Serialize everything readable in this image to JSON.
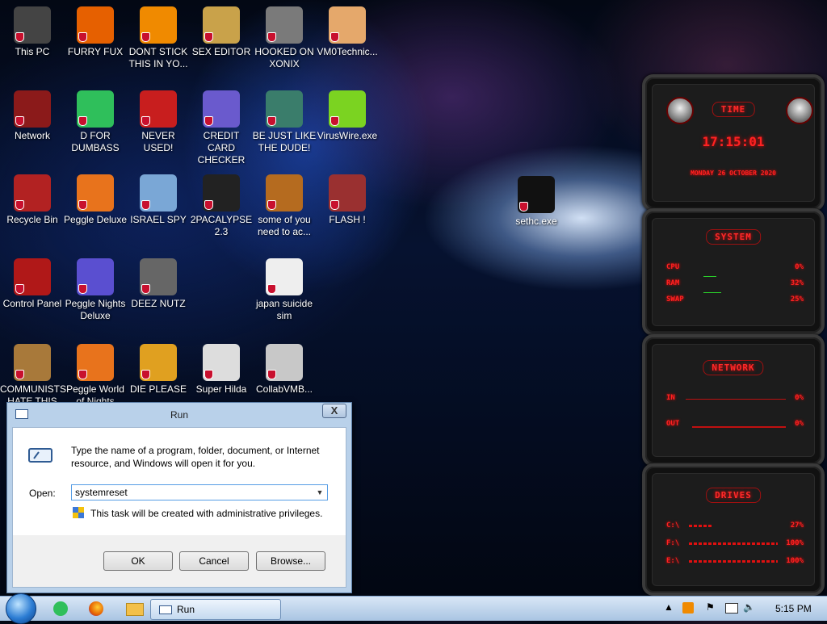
{
  "desktop": {
    "icons": [
      {
        "label": "This PC",
        "icon": "computer-icon",
        "color": "#444"
      },
      {
        "label": "FURRY FUX",
        "icon": "firefox-icon",
        "color": "#e66000"
      },
      {
        "label": "DONT STICK THIS IN YO...",
        "icon": "vlc-cone-icon",
        "color": "#f08a00"
      },
      {
        "label": "SEX EDITOR",
        "icon": "hxd-hex-editor-icon",
        "color": "#c9a24a"
      },
      {
        "label": "HOOKED ON XONIX",
        "icon": "xonix-game-icon",
        "color": "#7a7a7a"
      },
      {
        "label": "VM0Technic...",
        "icon": "technician-avatar-icon",
        "color": "#e5a86b"
      },
      {
        "label": "Network",
        "icon": "network-icon",
        "color": "#8b1a1a"
      },
      {
        "label": "D FOR DUMBASS",
        "icon": "messaging-app-icon",
        "color": "#2fbf5b"
      },
      {
        "label": "NEVER USED!",
        "icon": "dev-cpp-icon",
        "color": "#c81e1e"
      },
      {
        "label": "CREDIT CARD CHECKER",
        "icon": "credit-card-icon",
        "color": "#6a5acd"
      },
      {
        "label": "BE JUST LIKE THE DUDE!",
        "icon": "santa-avatar-icon",
        "color": "#3a7d6b"
      },
      {
        "label": "VirusWire.exe",
        "icon": "lime-slice-icon",
        "color": "#7bd321"
      },
      {
        "label": "Recycle Bin",
        "icon": "recycle-bin-icon",
        "color": "#b22222"
      },
      {
        "label": "Peggle Deluxe",
        "icon": "peggle-icon",
        "color": "#e8731c"
      },
      {
        "label": "ISRAEL SPY",
        "icon": "network-share-icon",
        "color": "#7aa7d6"
      },
      {
        "label": "2PACALYPSE 2.3",
        "icon": "terminal-icon",
        "color": "#222"
      },
      {
        "label": "some of you need to ac...",
        "icon": "cartoon-dog-icon",
        "color": "#b56b1f"
      },
      {
        "label": "FLASH !",
        "icon": "flash-icon",
        "color": "#9a3030"
      },
      {
        "label": "Control Panel",
        "icon": "control-panel-icon",
        "color": "#b01818"
      },
      {
        "label": "Peggle Nights Deluxe",
        "icon": "peggle-nights-icon",
        "color": "#5a4fd0"
      },
      {
        "label": "DEEZ NUTZ",
        "icon": "stacked-windows-icon",
        "color": "#666"
      },
      {
        "label": "japan suicide sim",
        "icon": "document-icon",
        "color": "#eee"
      },
      {
        "label": "COMMUNISTS HATE THIS O...",
        "icon": "money-bag-icon",
        "color": "#a8793a"
      },
      {
        "label": "Peggle World of Nights",
        "icon": "peggle-world-icon",
        "color": "#e8731c"
      },
      {
        "label": "DIE PLEASE",
        "icon": "director-icon",
        "color": "#e0a020"
      },
      {
        "label": "Super Hilda",
        "icon": "pixel-cat-icon",
        "color": "#ddd"
      },
      {
        "label": "CollabVMB...",
        "icon": "monitor-icon",
        "color": "#c8c8c8"
      },
      {
        "label": "sethc.exe",
        "icon": "console-icon",
        "color": "#111"
      }
    ]
  },
  "widget": {
    "time": {
      "title": "TIME",
      "clock": "17:15:01",
      "date": "MONDAY 26 OCTOBER 2020"
    },
    "system": {
      "title": "SYSTEM",
      "rows": [
        {
          "label": "CPU",
          "value": "0%"
        },
        {
          "label": "RAM",
          "value": "32%"
        },
        {
          "label": "SWAP",
          "value": "25%"
        }
      ]
    },
    "network": {
      "title": "NETWORK",
      "rows": [
        {
          "label": "IN",
          "value": "0%"
        },
        {
          "label": "OUT",
          "value": "0%"
        }
      ]
    },
    "drives": {
      "title": "DRIVES",
      "rows": [
        {
          "label": "C:\\",
          "value": "27%"
        },
        {
          "label": "F:\\",
          "value": "100%"
        },
        {
          "label": "E:\\",
          "value": "100%"
        }
      ]
    }
  },
  "run_dialog": {
    "title": "Run",
    "description": "Type the name of a program, folder, document, or Internet resource, and Windows will open it for you.",
    "open_label": "Open:",
    "open_value": "systemreset",
    "admin_note": "This task will be created with administrative privileges.",
    "ok_label": "OK",
    "cancel_label": "Cancel",
    "browse_label": "Browse...",
    "close_label": "X"
  },
  "taskbar": {
    "run_task_label": "Run",
    "time": "5:15 PM"
  }
}
